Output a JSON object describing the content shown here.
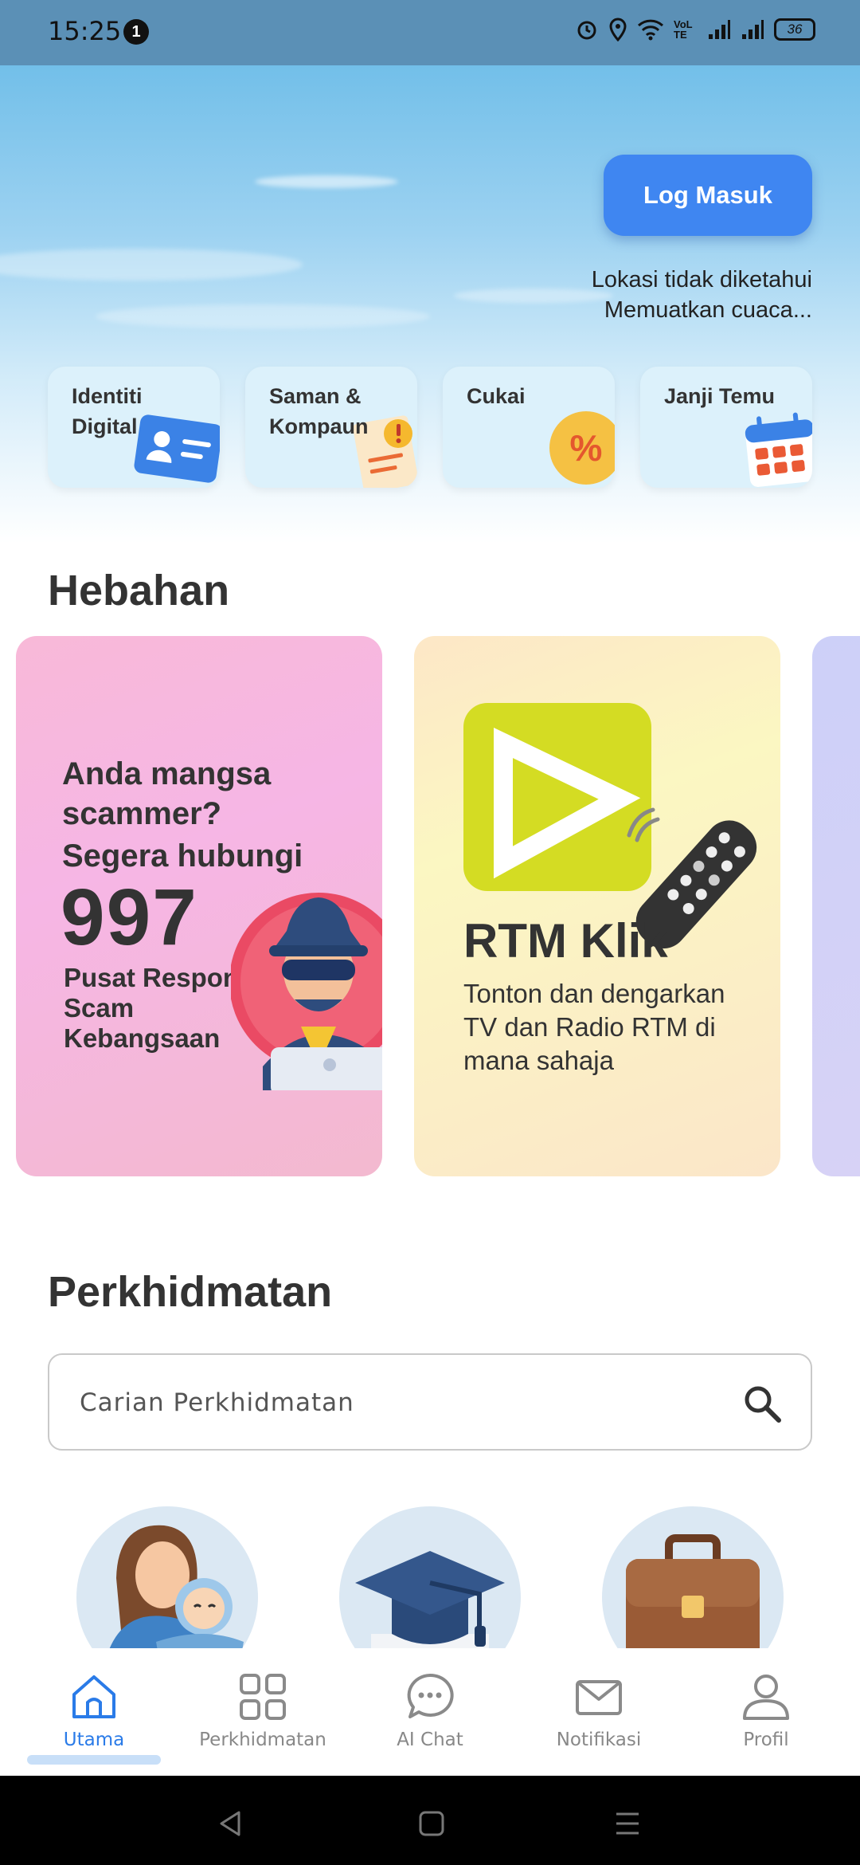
{
  "status_bar": {
    "time": "15:25",
    "notification_count": "1",
    "battery": "36",
    "network_label": "VoLTE"
  },
  "hero": {
    "login_button": "Log Masuk",
    "location_text": "Lokasi tidak diketahui",
    "weather_text": "Memuatkan cuaca..."
  },
  "quick_actions": [
    {
      "label": "Identiti Digital",
      "icon": "id-card-icon"
    },
    {
      "label": "Saman & Kompaun",
      "icon": "summons-icon"
    },
    {
      "label": "Cukai",
      "icon": "percent-icon"
    },
    {
      "label": "Janji Temu",
      "icon": "calendar-icon"
    }
  ],
  "announcements": {
    "heading": "Hebahan",
    "cards": [
      {
        "line1": "Anda mangsa scammer?",
        "line2": "Segera hubungi",
        "number": "997",
        "org": "Pusat Respons Scam Kebangsaan",
        "colors": [
          "#f8b9d8",
          "#f3b9cf"
        ]
      },
      {
        "title": "RTM Klik",
        "description": "Tonton dan dengarkan TV dan Radio RTM di mana sahaja",
        "accent": "#d4dc23"
      }
    ]
  },
  "services": {
    "heading": "Perkhidmatan",
    "search_placeholder": "Carian Perkhidmatan",
    "items": [
      "mother-baby-icon",
      "graduation-cap-icon",
      "briefcase-icon"
    ]
  },
  "bottom_nav": {
    "items": [
      {
        "label": "Utama",
        "icon": "home-icon",
        "active": true
      },
      {
        "label": "Perkhidmatan",
        "icon": "grid-icon",
        "active": false
      },
      {
        "label": "AI Chat",
        "icon": "chat-bubble-icon",
        "active": false
      },
      {
        "label": "Notifikasi",
        "icon": "envelope-icon",
        "active": false
      },
      {
        "label": "Profil",
        "icon": "user-icon",
        "active": false
      }
    ],
    "active_color": "#2a7be8",
    "inactive_color": "#888888"
  },
  "colors": {
    "primary": "#3f86f1",
    "status_bar": "#5b90b6"
  }
}
